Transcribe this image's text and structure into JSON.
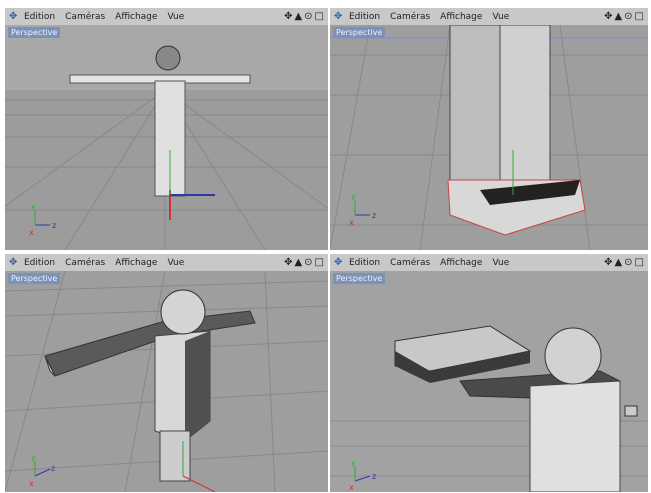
{
  "menu": {
    "edition": "Edition",
    "cameras": "Caméras",
    "affichage": "Affichage",
    "vue": "Vue"
  },
  "icons": [
    "move-icon",
    "rotate-icon",
    "zoom-icon",
    "maximize-icon"
  ],
  "viewports": [
    {
      "camera": "Perspective"
    },
    {
      "camera": "Perspective"
    },
    {
      "camera": "Perspective"
    },
    {
      "camera": "Perspective"
    }
  ],
  "axes": {
    "x": "x",
    "y": "y",
    "z": "z"
  }
}
